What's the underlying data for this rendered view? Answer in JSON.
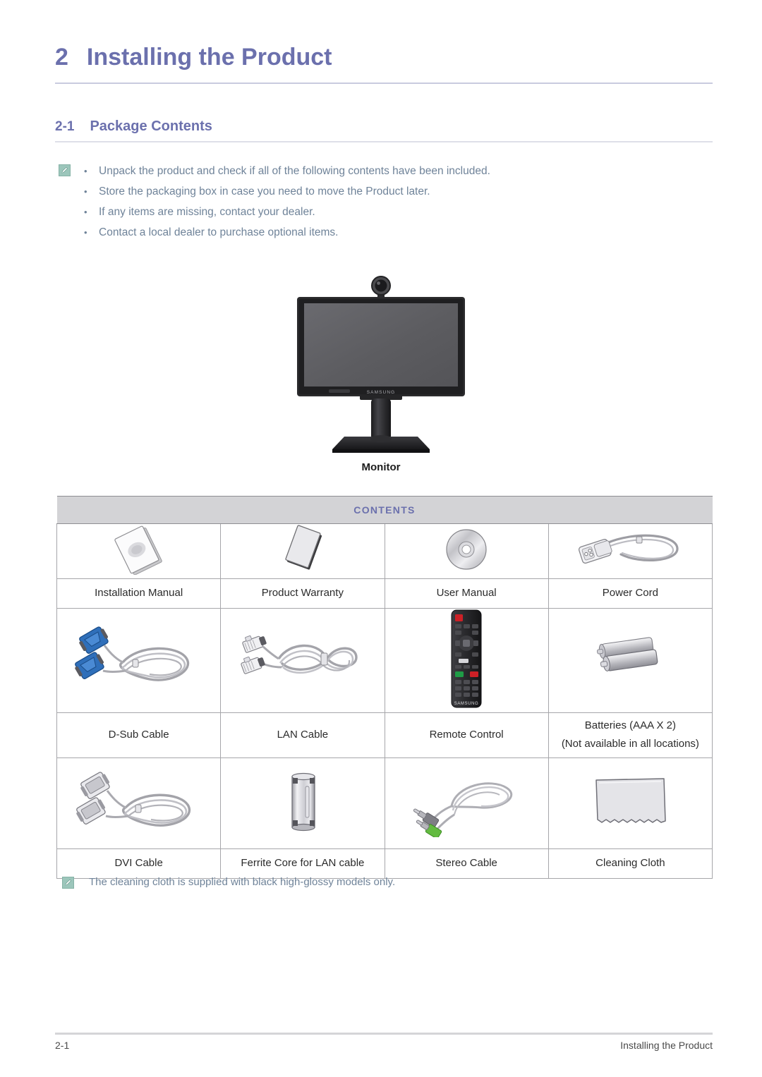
{
  "chapter": {
    "number": "2",
    "title": "Installing the Product"
  },
  "section": {
    "number": "2-1",
    "title": "Package Contents"
  },
  "note": {
    "icon": "note-pencil-icon",
    "bullets": [
      "Unpack the product and check if all of the following contents have been included.",
      "Store the packaging box in case you need to move the Product later.",
      "If any items are missing, contact your dealer.",
      "Contact a local dealer to purchase optional items."
    ]
  },
  "hero": {
    "caption": "Monitor",
    "image_name": "samsung-monitor-with-webcam"
  },
  "table": {
    "header": "CONTENTS",
    "columns": 4,
    "rows": [
      [
        {
          "label": "Installation Manual",
          "sublabel": "",
          "icon": "booklet-icon"
        },
        {
          "label": "Product Warranty",
          "sublabel": "",
          "icon": "card-icon"
        },
        {
          "label": "User Manual",
          "sublabel": "",
          "icon": "cd-disc-icon"
        },
        {
          "label": "Power Cord",
          "sublabel": "",
          "icon": "power-cord-icon"
        }
      ],
      [
        {
          "label": "D-Sub Cable",
          "sublabel": "",
          "icon": "dsub-cable-icon"
        },
        {
          "label": "LAN Cable",
          "sublabel": "",
          "icon": "lan-cable-icon"
        },
        {
          "label": "Remote Control",
          "sublabel": "",
          "icon": "remote-control-icon"
        },
        {
          "label": "Batteries (AAA X 2)",
          "sublabel": "(Not available in all locations)",
          "icon": "batteries-icon"
        }
      ],
      [
        {
          "label": "DVI Cable",
          "sublabel": "",
          "icon": "dvi-cable-icon"
        },
        {
          "label": "Ferrite Core for LAN cable",
          "sublabel": "",
          "icon": "ferrite-core-icon"
        },
        {
          "label": "Stereo Cable",
          "sublabel": "",
          "icon": "stereo-cable-icon"
        },
        {
          "label": "Cleaning Cloth",
          "sublabel": "",
          "icon": "cleaning-cloth-icon"
        }
      ]
    ]
  },
  "footnote": {
    "icon": "note-pencil-icon",
    "text": "The cleaning cloth is supplied with black high-glossy models only."
  },
  "footer": {
    "left": "2-1",
    "right": "Installing the Product"
  },
  "colors": {
    "heading": "#6b70ad",
    "body_note": "#6f8399",
    "table_header_bg": "#d3d3d6",
    "table_border": "#a6a6aa",
    "note_icon_bg": "#9cc6bb"
  }
}
